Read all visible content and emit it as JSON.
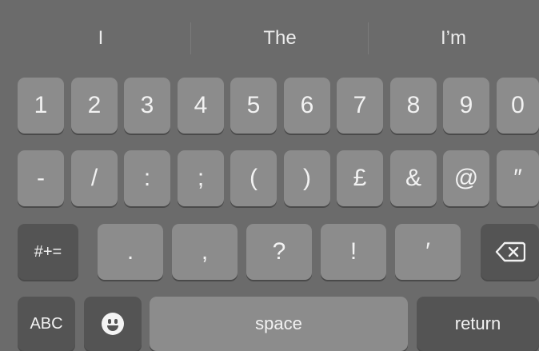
{
  "suggestions": [
    "I",
    "The",
    "I’m"
  ],
  "rows": {
    "numbers": [
      "1",
      "2",
      "3",
      "4",
      "5",
      "6",
      "7",
      "8",
      "9",
      "0"
    ],
    "symbols": [
      "-",
      "/",
      ":",
      ";",
      "(",
      ")",
      "£",
      "&",
      "@",
      "″"
    ],
    "punct": [
      ".",
      ",",
      "?",
      "!",
      "′"
    ]
  },
  "keys": {
    "more_symbols": "#+=",
    "abc": "ABC",
    "space": "space",
    "return": "return",
    "emoji_icon": "emoji-face-icon",
    "backspace_icon": "backspace-icon"
  }
}
